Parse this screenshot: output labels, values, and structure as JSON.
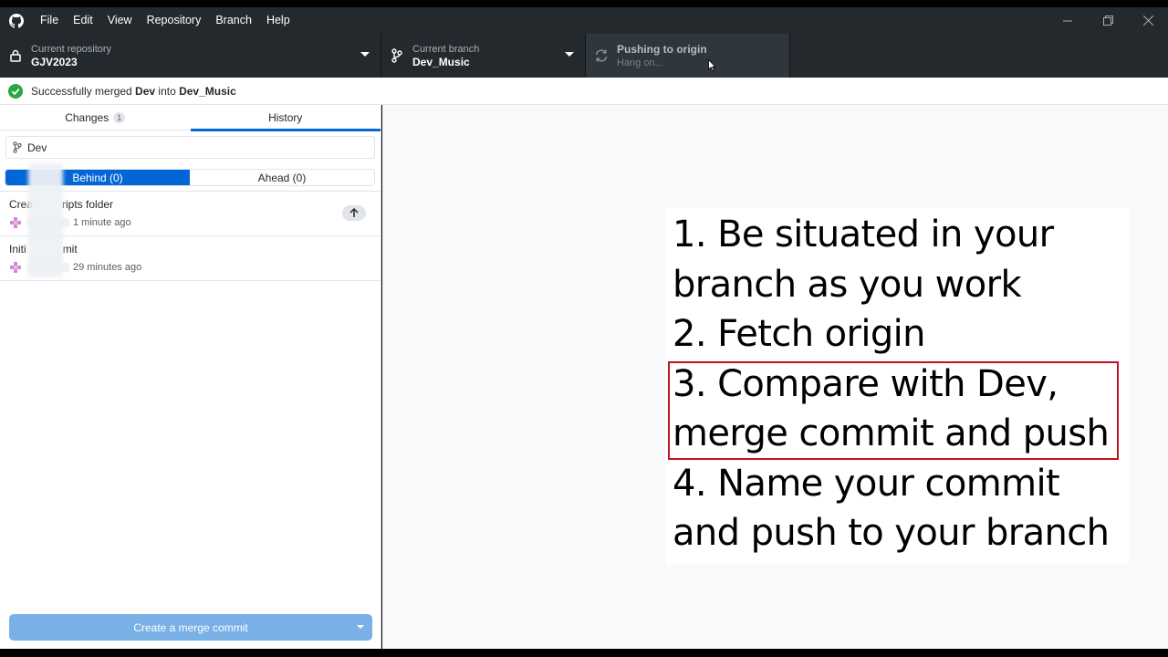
{
  "menubar": {
    "items": [
      "File",
      "Edit",
      "View",
      "Repository",
      "Branch",
      "Help"
    ]
  },
  "toolbar": {
    "repo_label": "Current repository",
    "repo_value": "GJV2023",
    "branch_label": "Current branch",
    "branch_value": "Dev_Music",
    "push_label": "Pushing to origin",
    "push_sub": "Hang on..."
  },
  "banner": {
    "prefix": "Successfully merged ",
    "source": "Dev",
    "middle": " into ",
    "target": "Dev_Music"
  },
  "sidebar": {
    "tabs": [
      {
        "label": "Changes",
        "count": "1"
      },
      {
        "label": "History"
      }
    ],
    "branch_filter": "Dev",
    "segments": [
      "Behind (0)",
      "Ahead (0)"
    ],
    "commits": [
      {
        "title_left": "Crea",
        "title_right": "ripts folder",
        "time": "1 minute ago"
      },
      {
        "title_left": "Initi",
        "title_right": "mit",
        "time": "29 minutes ago"
      }
    ],
    "merge_button": "Create a merge commit"
  },
  "overlay": {
    "steps": [
      "1. Be situated in your",
      "branch as you work",
      "2. Fetch origin",
      "3. Compare with Dev,",
      "merge commit and push",
      "4. Name your commit",
      "and push to your branch"
    ],
    "highlight_color": "#c0121e"
  },
  "colors": {
    "accent": "#0366d6",
    "toolbar_bg": "#24292e",
    "success": "#28a745"
  }
}
